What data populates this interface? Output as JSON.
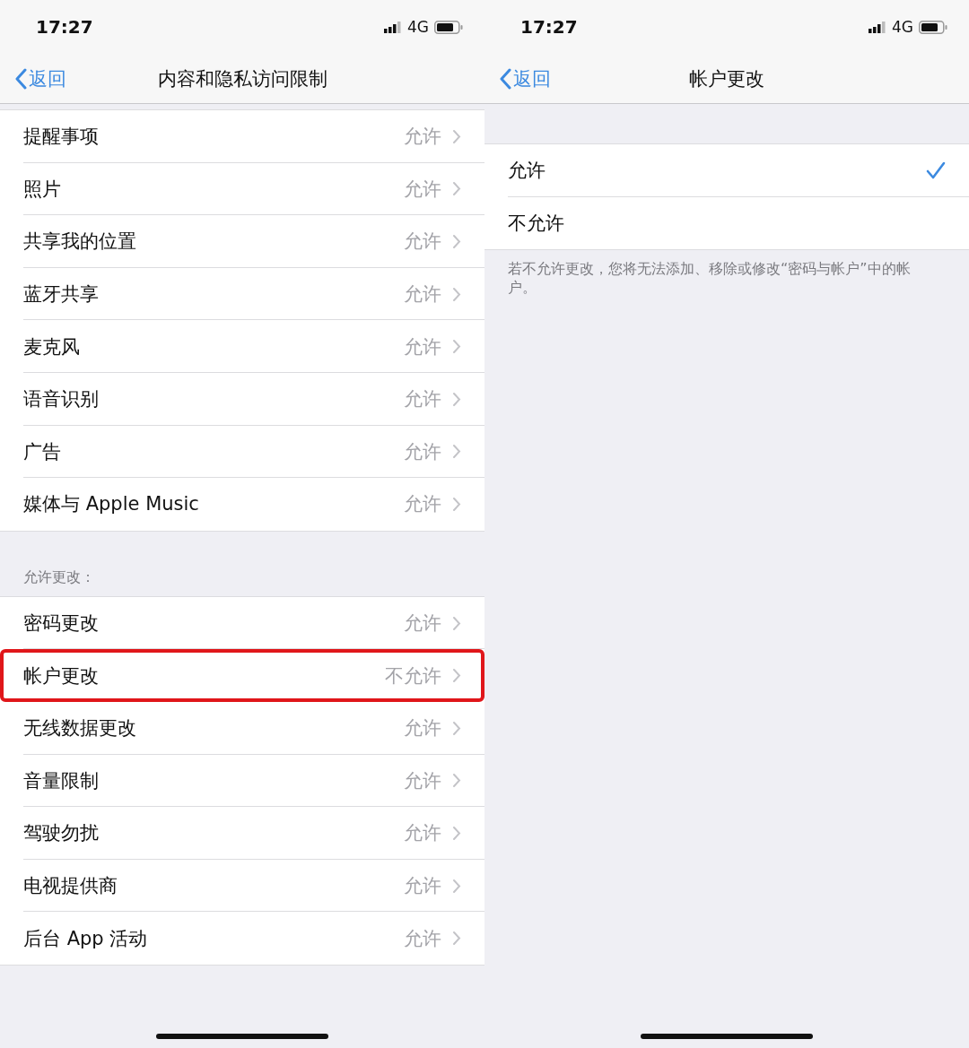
{
  "settings_screen": {
    "status_bar": {
      "time": "17:27",
      "network": "4G"
    },
    "nav": {
      "back": "返回",
      "title": "内容和隐私访问限制"
    },
    "sections": [
      {
        "rows": [
          {
            "label": "提醒事项",
            "value": "允许",
            "highlighted": false
          },
          {
            "label": "照片",
            "value": "允许",
            "highlighted": false
          },
          {
            "label": "共享我的位置",
            "value": "允许",
            "highlighted": false
          },
          {
            "label": "蓝牙共享",
            "value": "允许",
            "highlighted": false
          },
          {
            "label": "麦克风",
            "value": "允许",
            "highlighted": false
          },
          {
            "label": "语音识别",
            "value": "允许",
            "highlighted": false
          },
          {
            "label": "广告",
            "value": "允许",
            "highlighted": false
          },
          {
            "label": "媒体与 Apple Music",
            "value": "允许",
            "highlighted": false
          }
        ]
      },
      {
        "header": "允许更改：",
        "rows": [
          {
            "label": "密码更改",
            "value": "允许",
            "highlighted": false
          },
          {
            "label": "帐户更改",
            "value": "不允许",
            "highlighted": true
          },
          {
            "label": "无线数据更改",
            "value": "允许",
            "highlighted": false
          },
          {
            "label": "音量限制",
            "value": "允许",
            "highlighted": false
          },
          {
            "label": "驾驶勿扰",
            "value": "允许",
            "highlighted": false
          },
          {
            "label": "电视提供商",
            "value": "允许",
            "highlighted": false
          },
          {
            "label": "后台 App 活动",
            "value": "允许",
            "highlighted": false
          }
        ]
      }
    ]
  },
  "detail_screen": {
    "status_bar": {
      "time": "17:27",
      "network": "4G"
    },
    "nav": {
      "back": "返回",
      "title": "帐户更改"
    },
    "options": [
      {
        "label": "允许",
        "selected": true
      },
      {
        "label": "不允许",
        "selected": false
      }
    ],
    "footer": "若不允许更改，您将无法添加、移除或修改“密码与帐户”中的帐户。"
  }
}
